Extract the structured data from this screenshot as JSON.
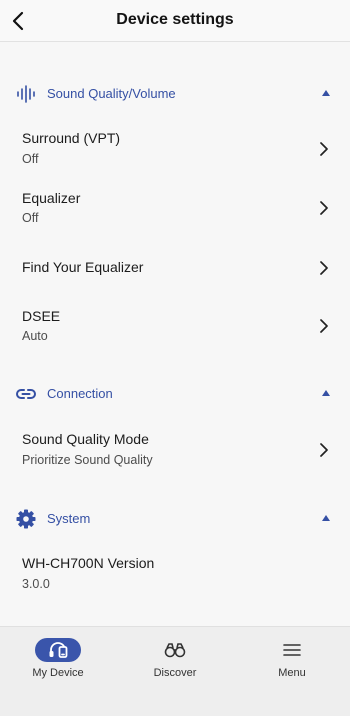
{
  "header": {
    "title": "Device settings"
  },
  "sections": {
    "sound": {
      "label": "Sound Quality/Volume",
      "icon": "sound-wave-icon"
    },
    "connection": {
      "label": "Connection",
      "icon": "link-icon"
    },
    "system": {
      "label": "System",
      "icon": "gear-icon"
    }
  },
  "rows": {
    "surround": {
      "title": "Surround (VPT)",
      "value": "Off"
    },
    "equalizer": {
      "title": "Equalizer",
      "value": "Off"
    },
    "find_eq": {
      "title": "Find Your Equalizer"
    },
    "dsee": {
      "title": "DSEE",
      "value": "Auto"
    },
    "sound_quality_mode": {
      "title": "Sound Quality Mode",
      "value": "Prioritize Sound Quality"
    },
    "version": {
      "title": "WH-CH700N Version",
      "value": "3.0.0"
    }
  },
  "bottom_nav": {
    "my_device": "My Device",
    "discover": "Discover",
    "menu": "Menu"
  },
  "colors": {
    "accent": "#3550a4",
    "background": "#f7f7f7"
  }
}
